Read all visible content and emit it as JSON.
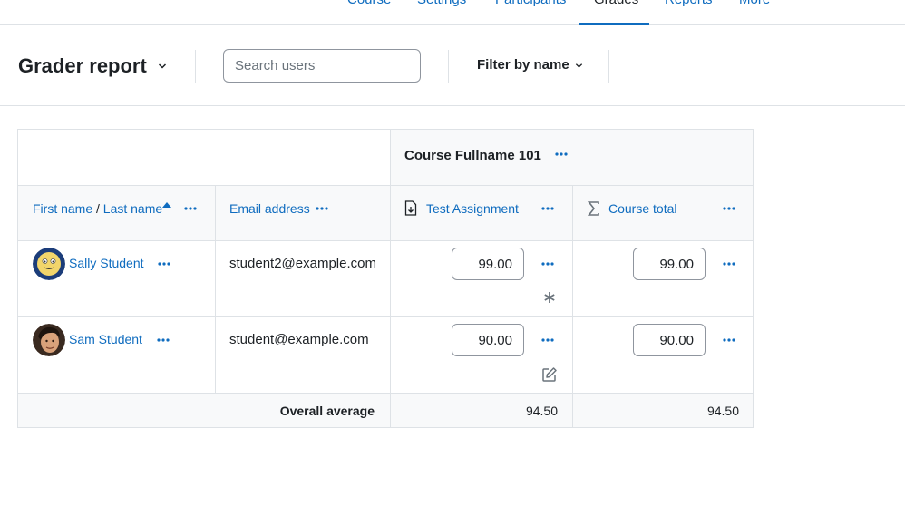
{
  "topnav": {
    "tabs": [
      {
        "label": "Course"
      },
      {
        "label": "Settings"
      },
      {
        "label": "Participants"
      },
      {
        "label": "Grades"
      },
      {
        "label": "Reports"
      },
      {
        "label": "More"
      }
    ]
  },
  "toolbar": {
    "title": "Grader report",
    "search_placeholder": "Search users",
    "filter_label": "Filter by name"
  },
  "grader": {
    "course_name": "Course Fullname 101",
    "headers": {
      "first_name": "First name",
      "separator": "/",
      "last_name": "Last name",
      "email": "Email address",
      "assignment": "Test Assignment",
      "course_total": "Course total"
    },
    "rows": [
      {
        "name": "Sally Student",
        "email": "student2@example.com",
        "assignment_grade": "99.00",
        "course_total": "99.00"
      },
      {
        "name": "Sam Student",
        "email": "student@example.com",
        "assignment_grade": "90.00",
        "course_total": "90.00"
      }
    ],
    "overall": {
      "label": "Overall average",
      "assignment": "94.50",
      "course_total": "94.50"
    }
  },
  "colors": {
    "accent": "#0f6cbf",
    "border": "#dee2e6",
    "header_bg": "#f8f9fa"
  }
}
